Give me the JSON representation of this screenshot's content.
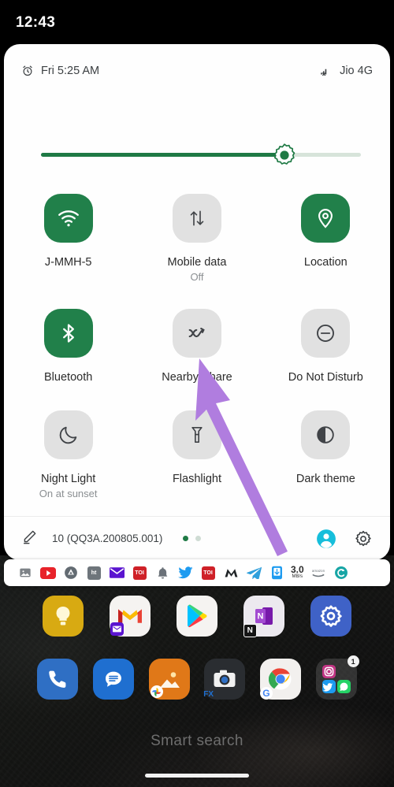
{
  "status_bar": {
    "clock": "12:43"
  },
  "quick_settings": {
    "header": {
      "alarm_icon": "alarm-clock-icon",
      "alarm_text": "Fri 5:25 AM",
      "signal_icon": "signal-no-service-icon",
      "carrier_text": "Jio 4G"
    },
    "brightness": {
      "name": "brightness-slider",
      "value_percent": 76
    },
    "tiles": [
      {
        "label": "J-MMH-5",
        "sub": "",
        "state": "on",
        "icon": "wifi-icon"
      },
      {
        "label": "Mobile data",
        "sub": "Off",
        "state": "off",
        "icon": "mobile-data-icon"
      },
      {
        "label": "Location",
        "sub": "",
        "state": "on",
        "icon": "location-pin-icon"
      },
      {
        "label": "Bluetooth",
        "sub": "",
        "state": "on",
        "icon": "bluetooth-icon"
      },
      {
        "label": "Nearby Share",
        "sub": "",
        "state": "off",
        "icon": "nearby-share-icon"
      },
      {
        "label": "Do Not Disturb",
        "sub": "",
        "state": "off",
        "icon": "do-not-disturb-icon"
      },
      {
        "label": "Night Light",
        "sub": "On at sunset",
        "state": "off",
        "icon": "moon-icon"
      },
      {
        "label": "Flashlight",
        "sub": "",
        "state": "off",
        "icon": "flashlight-icon"
      },
      {
        "label": "Dark theme",
        "sub": "",
        "state": "off",
        "icon": "contrast-circle-icon"
      }
    ],
    "footer": {
      "edit_icon": "edit-pencil-icon",
      "build_label": "10 (QQ3A.200805.001)",
      "page_dots": 2,
      "active_dot": 0,
      "user_icon": "user-avatar-icon",
      "settings_icon": "gear-icon"
    }
  },
  "notification_strip": {
    "icons": [
      {
        "name": "gallery-icon",
        "text": "",
        "color": "#7d8287"
      },
      {
        "name": "youtube-icon",
        "text": "",
        "color": "#e8232a"
      },
      {
        "name": "apus-icon",
        "text": "",
        "color": "#636b72"
      },
      {
        "name": "hindustan-times-icon",
        "text": "ht",
        "color": "#6e757b"
      },
      {
        "name": "mail-envelope-icon",
        "text": "",
        "color": "#5a14d0"
      },
      {
        "name": "toi-icon",
        "text": "TOI",
        "color": "#cf2128"
      },
      {
        "name": "bell-icon",
        "text": "",
        "color": "#6b7279"
      },
      {
        "name": "twitter-icon",
        "text": "",
        "color": "#1d9bf0"
      },
      {
        "name": "toi-icon",
        "text": "TOI",
        "color": "#cf2128"
      },
      {
        "name": "mint-icon",
        "text": "M",
        "color": "#1f2326"
      },
      {
        "name": "telegram-icon",
        "text": "",
        "color": "#2f9fdc"
      },
      {
        "name": "phone-app-icon",
        "text": "",
        "color": "#1d9bf0"
      }
    ],
    "speed": {
      "value": "3.0",
      "unit": "MB/s"
    },
    "trailing_icons": [
      {
        "name": "amazon-icon",
        "color": "#6e757b"
      },
      {
        "name": "c-app-icon",
        "color": "#17a5a5"
      }
    ]
  },
  "home_screen": {
    "row1": [
      {
        "name": "google-keep-icon",
        "color": "#d8aa12"
      },
      {
        "name": "gmail-icon",
        "color": "#f5f3f1"
      },
      {
        "name": "play-store-icon",
        "color": "#f5f3f1"
      },
      {
        "name": "onenote-icon",
        "color": "#ece9ef"
      },
      {
        "name": "settings-icon",
        "color": "#3f62c7"
      }
    ],
    "row2": [
      {
        "name": "phone-icon",
        "color": "#2f6fc4"
      },
      {
        "name": "messages-icon",
        "color": "#1f6fd0"
      },
      {
        "name": "gallery-app-icon",
        "color": "#e07818"
      },
      {
        "name": "camera-icon",
        "color": "#2a2d31"
      },
      {
        "name": "chrome-icon",
        "color": "#f2f0ee"
      },
      {
        "name": "social-folder-icon",
        "color": "#4a4a4a",
        "badge": "1"
      }
    ],
    "search_placeholder": "Smart search",
    "nav_pill": "gesture-nav-pill"
  },
  "annotation": {
    "arrow": {
      "name": "pointer-arrow",
      "color": "#b07ddf",
      "points_to": "Nearby Share"
    }
  }
}
